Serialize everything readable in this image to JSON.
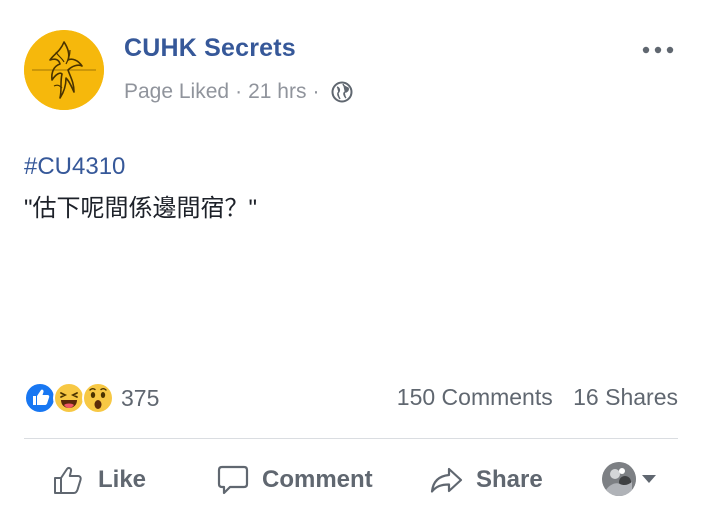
{
  "post": {
    "page_name": "CUHK Secrets",
    "status": "Page Liked",
    "separator": "·",
    "time": "21 hrs",
    "privacy_icon": "globe-icon",
    "more_icon": "more-options-icon",
    "hashtag": "#CU4310",
    "text": "\"估下呢間係邊間宿？\""
  },
  "reactions": {
    "icons": [
      "like",
      "haha",
      "wow"
    ],
    "count": "375"
  },
  "engagement": {
    "comments": "150 Comments",
    "shares": "16 Shares"
  },
  "actions": {
    "like_label": "Like",
    "comment_label": "Comment",
    "share_label": "Share"
  },
  "colors": {
    "link_blue": "#365899",
    "meta_gray": "#90949c",
    "action_gray": "#606770",
    "avatar_yellow": "#f6b80c",
    "like_blue": "#1877f2",
    "emoji_yellow": "#f7c844"
  }
}
